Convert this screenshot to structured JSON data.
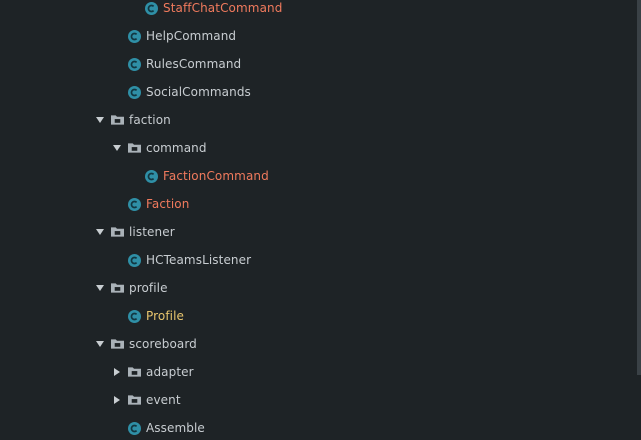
{
  "tree": {
    "items": [
      {
        "label": "StaffChatCommand",
        "kind": "class"
      },
      {
        "label": "HelpCommand",
        "kind": "class"
      },
      {
        "label": "RulesCommand",
        "kind": "class"
      },
      {
        "label": "SocialCommands",
        "kind": "class"
      },
      {
        "label": "faction",
        "kind": "folder",
        "state": "expanded"
      },
      {
        "label": "command",
        "kind": "folder",
        "state": "expanded"
      },
      {
        "label": "FactionCommand",
        "kind": "class"
      },
      {
        "label": "Faction",
        "kind": "class"
      },
      {
        "label": "listener",
        "kind": "folder",
        "state": "expanded"
      },
      {
        "label": "HCTeamsListener",
        "kind": "class"
      },
      {
        "label": "profile",
        "kind": "folder",
        "state": "expanded"
      },
      {
        "label": "Profile",
        "kind": "class"
      },
      {
        "label": "scoreboard",
        "kind": "folder",
        "state": "expanded"
      },
      {
        "label": "adapter",
        "kind": "folder",
        "state": "collapsed"
      },
      {
        "label": "event",
        "kind": "folder",
        "state": "collapsed"
      },
      {
        "label": "Assemble",
        "kind": "class"
      }
    ]
  },
  "colors": {
    "background": "#1e2326",
    "text_default": "#c8cdd1",
    "text_modified": "#f07a5d",
    "text_warning": "#e8c56d",
    "class_icon": "#2f8fa6",
    "folder_icon": "#aab2b8"
  },
  "icons": {
    "class": "class-c-icon",
    "folder": "folder-icon",
    "expanded": "triangle-down-icon",
    "collapsed": "triangle-right-icon"
  }
}
